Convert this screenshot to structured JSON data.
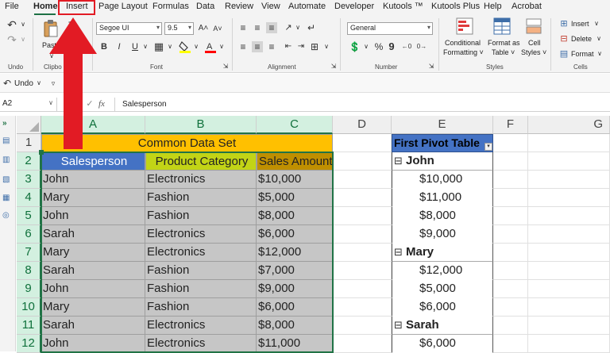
{
  "menu": {
    "tabs": [
      "File",
      "Home",
      "Insert",
      "Page Layout",
      "Formulas",
      "Data",
      "Review",
      "View",
      "Automate",
      "Developer",
      "Kutools ™",
      "Kutools Plus",
      "Help",
      "Acrobat"
    ],
    "active_tab": "Home",
    "highlighted_tab": "Insert"
  },
  "ribbon": {
    "groups": {
      "undo": "Undo",
      "clipboard": "Clipbo",
      "font": "Font",
      "alignment": "Alignment",
      "number": "Number",
      "styles": "Styles",
      "cells": "Cells"
    },
    "paste_label": "Paste",
    "font_name": "Segoe UI",
    "font_size": "9.5",
    "number_format": "General",
    "conditional_formatting": [
      "Conditional",
      "Formatting ˅"
    ],
    "format_as_table": [
      "Format as",
      "Table ˅"
    ],
    "cell_styles": [
      "Cell",
      "Styles ˅"
    ],
    "insert": "Insert",
    "delete": "Delete",
    "format": "Format",
    "bold": "B",
    "italic": "I",
    "underline": "U",
    "percent": "%",
    "comma": "9"
  },
  "qat": {
    "undo_label": "Undo"
  },
  "formula_bar": {
    "name_box": "A2",
    "fx": "fx",
    "content": "Salesperson"
  },
  "sheet": {
    "columns": [
      "A",
      "B",
      "C",
      "D",
      "E",
      "F",
      "G"
    ],
    "rows": [
      "1",
      "2",
      "3",
      "4",
      "5",
      "6",
      "7",
      "8",
      "9",
      "10",
      "11",
      "12"
    ],
    "title": "Common Data Set",
    "headers": [
      "Salesperson",
      "Product Category",
      "Sales Amount"
    ],
    "data": [
      [
        "John",
        "Electronics",
        "$10,000"
      ],
      [
        "Mary",
        "Fashion",
        "$5,000"
      ],
      [
        "John",
        "Fashion",
        "$8,000"
      ],
      [
        "Sarah",
        "Electronics",
        "$6,000"
      ],
      [
        "Mary",
        "Electronics",
        "$12,000"
      ],
      [
        "Sarah",
        "Fashion",
        "$7,000"
      ],
      [
        "John",
        "Fashion",
        "$9,000"
      ],
      [
        "Mary",
        "Fashion",
        "$6,000"
      ],
      [
        "Sarah",
        "Electronics",
        "$8,000"
      ],
      [
        "John",
        "Electronics",
        "$11,000"
      ]
    ]
  },
  "pivot": {
    "header": "First Pivot Table",
    "collapse_symbol": "⊟",
    "rows": [
      {
        "type": "group",
        "text": "John"
      },
      {
        "type": "value",
        "text": "$10,000"
      },
      {
        "type": "value",
        "text": "$11,000"
      },
      {
        "type": "value",
        "text": "$8,000"
      },
      {
        "type": "value",
        "text": "$9,000"
      },
      {
        "type": "group",
        "text": "Mary"
      },
      {
        "type": "value",
        "text": "$12,000"
      },
      {
        "type": "value",
        "text": "$5,000"
      },
      {
        "type": "value",
        "text": "$6,000"
      },
      {
        "type": "group",
        "text": "Sarah"
      },
      {
        "type": "value",
        "text": "$6,000"
      }
    ]
  },
  "colors": {
    "title_fill": "#ffc000",
    "header_a": "#4472c4",
    "header_b": "#c2d416",
    "header_c": "#bf8f00",
    "data_fill": "#c6c6c6",
    "pivot_header": "#4472c4",
    "annotation_red": "#e21b24",
    "excel_green": "#217346"
  }
}
